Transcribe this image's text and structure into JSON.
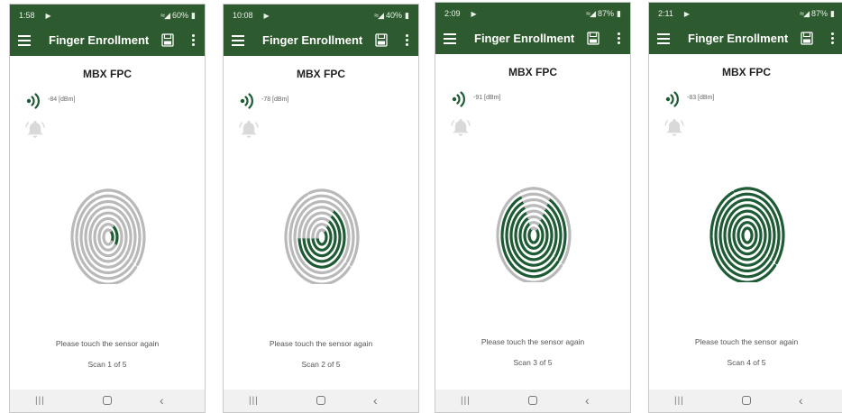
{
  "screens": [
    {
      "status": {
        "time": "1:58",
        "battery": "60%"
      },
      "title": "Finger Enrollment",
      "device": "MBX FPC",
      "rssi": "-84 [dBm]",
      "prompt": "Please touch the sensor again",
      "scan": "Scan 1 of 5",
      "progress": 0.2
    },
    {
      "status": {
        "time": "10:08",
        "battery": "40%"
      },
      "title": "Finger Enrollment",
      "device": "MBX FPC",
      "rssi": "-78 [dBm]",
      "prompt": "Please touch the sensor again",
      "scan": "Scan 2 of 5",
      "progress": 0.4
    },
    {
      "status": {
        "time": "2:09",
        "battery": "87%"
      },
      "title": "Finger Enrollment",
      "device": "MBX FPC",
      "rssi": "-91 [dBm]",
      "prompt": "Please touch the sensor again",
      "scan": "Scan 3 of 5",
      "progress": 0.6
    },
    {
      "status": {
        "time": "2:11",
        "battery": "87%"
      },
      "title": "Finger Enrollment",
      "device": "MBX FPC",
      "rssi": "-83 [dBm]",
      "prompt": "Please touch the sensor again",
      "scan": "Scan 4 of 5",
      "progress": 0.8
    }
  ],
  "icons": {
    "status_play": "play-store-icon",
    "wifi": "wifi-signal-icon",
    "menu": "hamburger-menu-icon",
    "save": "save-icon",
    "more": "more-vert-icon",
    "signal": "signal-strength-icon",
    "bell": "bell-icon",
    "fingerprint": "fingerprint-icon",
    "recents": "recents-icon",
    "home": "home-icon",
    "back": "back-icon"
  },
  "colors": {
    "brand": "#2d5a2e",
    "fill": "#1e5b35",
    "inactive": "#b9b9b9"
  }
}
